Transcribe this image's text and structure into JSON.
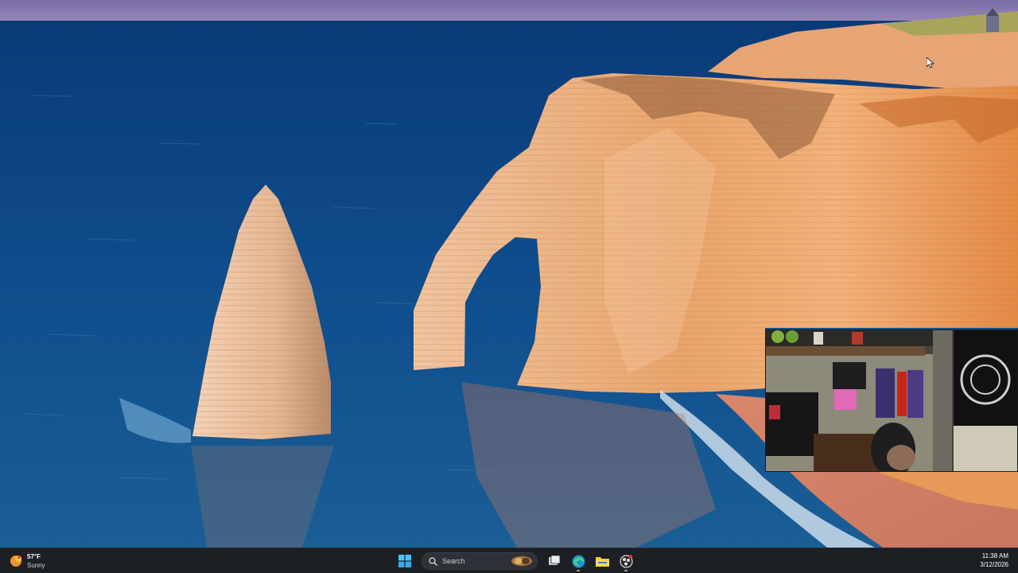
{
  "taskbar": {
    "weather": {
      "temperature": "57°F",
      "condition": "Sunny",
      "icon": "sun-cloud-icon"
    },
    "search": {
      "label": "Search",
      "icon": "search-icon"
    },
    "pinned": [
      {
        "name": "start-button",
        "icon": "windows-logo-icon"
      },
      {
        "name": "task-view-button",
        "icon": "task-view-icon"
      },
      {
        "name": "edge-button",
        "icon": "edge-icon"
      },
      {
        "name": "file-explorer-button",
        "icon": "folder-icon"
      },
      {
        "name": "obs-button",
        "icon": "record-icon"
      }
    ],
    "clock": {
      "time": "11:38 AM",
      "date": "3/12/2026"
    }
  },
  "desktop": {
    "wallpaper": "sea-cliffs-arch-landscape",
    "colors": {
      "sea": "#0f4a86",
      "cliff": "#e8a46a",
      "taskbar": "#1c1f24"
    }
  },
  "webcam_overlay": {
    "content": "webcam-feed-room"
  }
}
